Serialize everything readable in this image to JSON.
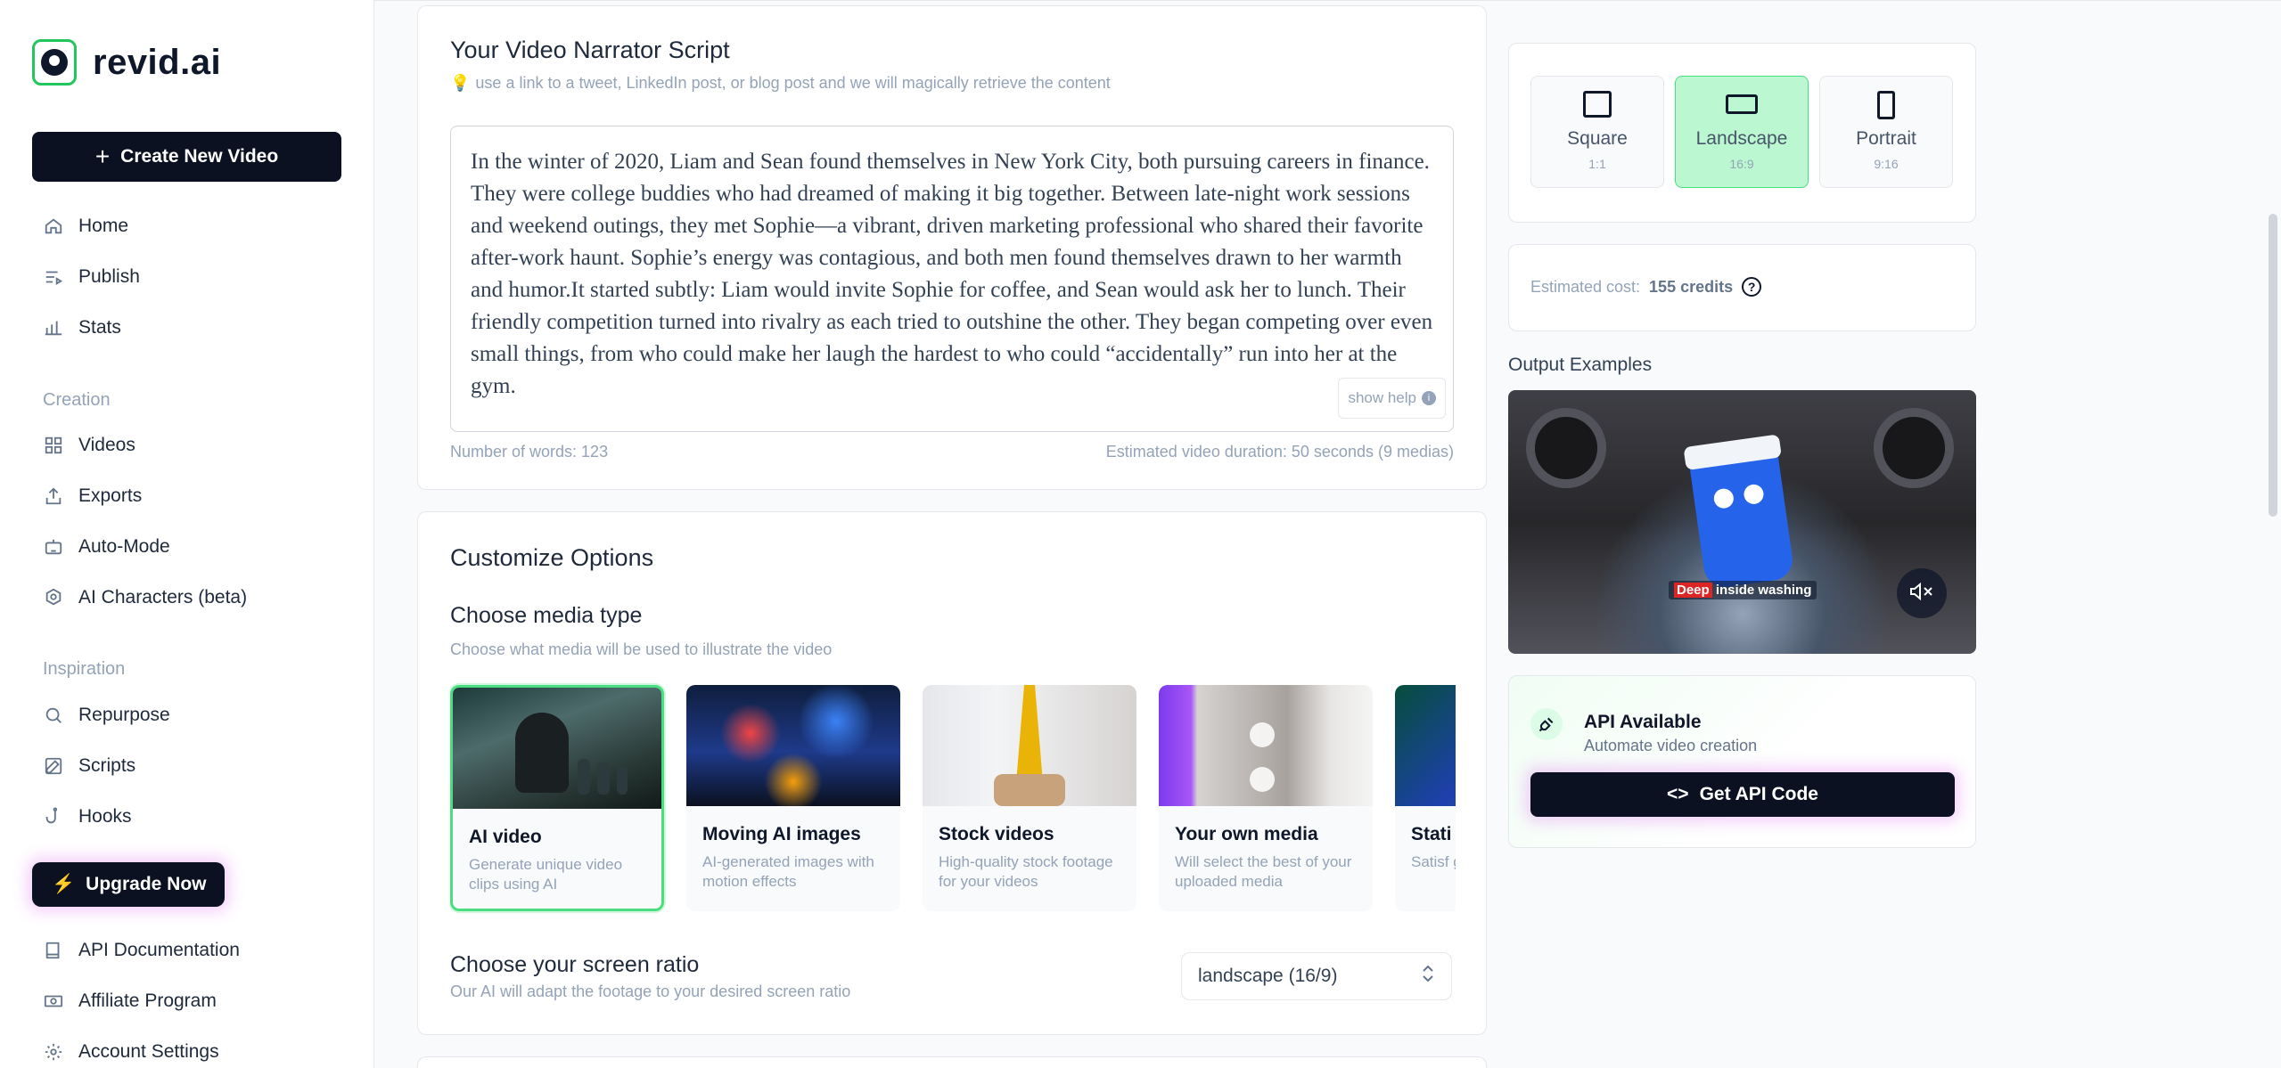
{
  "app": {
    "name": "revid.ai"
  },
  "sidebar": {
    "create_label": "Create New Video",
    "main_items": [
      {
        "label": "Home",
        "icon": "home-icon"
      },
      {
        "label": "Publish",
        "icon": "publish-icon"
      },
      {
        "label": "Stats",
        "icon": "stats-icon"
      }
    ],
    "creation_title": "Creation",
    "creation_items": [
      {
        "label": "Videos",
        "icon": "grid-icon"
      },
      {
        "label": "Exports",
        "icon": "export-icon"
      },
      {
        "label": "Auto-Mode",
        "icon": "robot-icon"
      },
      {
        "label": "AI Characters (beta)",
        "icon": "cog-icon"
      }
    ],
    "inspiration_title": "Inspiration",
    "inspiration_items": [
      {
        "label": "Repurpose",
        "icon": "search-icon"
      },
      {
        "label": "Scripts",
        "icon": "edit-icon"
      },
      {
        "label": "Hooks",
        "icon": "hook-icon"
      }
    ],
    "upgrade_label": "Upgrade Now",
    "bottom_items": [
      {
        "label": "API Documentation",
        "icon": "book-icon"
      },
      {
        "label": "Affiliate Program",
        "icon": "money-icon"
      },
      {
        "label": "Account Settings",
        "icon": "settings-icon"
      }
    ]
  },
  "script": {
    "title": "Your Video Narrator Script",
    "hint": "use a link to a tweet, LinkedIn post, or blog post and we will magically retrieve the content",
    "text": "In the winter of 2020, Liam and Sean found themselves in New York City, both pursuing careers in finance. They were college buddies who had dreamed of making it big together. Between late-night work sessions and weekend outings, they met Sophie—a vibrant, driven marketing professional who shared their favorite after-work haunt. Sophie’s energy was contagious, and both men found themselves drawn to her warmth and humor.It started subtly: Liam would invite Sophie for coffee, and Sean would ask her to lunch. Their friendly competition turned into rivalry as each tried to outshine the other. They began competing over even small things, from who could make her laugh the hardest to who could “accidentally” run into her at the gym.",
    "show_help": "show help",
    "word_count": "Number of words: 123",
    "duration": "Estimated video duration: 50 seconds (9 medias)"
  },
  "customize": {
    "title": "Customize Options",
    "media_title": "Choose media type",
    "media_sub": "Choose what media will be used to illustrate the video",
    "media_types": [
      {
        "title": "AI video",
        "desc": "Generate unique video clips using AI",
        "selected": true
      },
      {
        "title": "Moving AI images",
        "desc": "AI-generated images with motion effects",
        "selected": false
      },
      {
        "title": "Stock videos",
        "desc": "High-quality stock footage for your videos",
        "selected": false
      },
      {
        "title": "Your own media",
        "desc": "Will select the best of your uploaded media",
        "selected": false
      },
      {
        "title": "Stati",
        "desc": "Satisf grab a",
        "selected": false
      }
    ],
    "ratio_title": "Choose your screen ratio",
    "ratio_sub": "Our AI will adapt the footage to your desired screen ratio",
    "ratio_value": "landscape (16/9)"
  },
  "aspect": {
    "options": [
      {
        "name": "Square",
        "sub": "1:1",
        "active": false
      },
      {
        "name": "Landscape",
        "sub": "16:9",
        "active": true
      },
      {
        "name": "Portrait",
        "sub": "9:16",
        "active": false
      }
    ]
  },
  "cost": {
    "label": "Estimated cost:",
    "value": "155 credits"
  },
  "examples": {
    "label": "Output Examples",
    "caption_highlight": "Deep",
    "caption_rest": " inside washing"
  },
  "api": {
    "title": "API Available",
    "sub": "Automate video creation",
    "button": "Get API Code"
  },
  "colors": {
    "accent_green": "#4ade80",
    "dark": "#0b1120",
    "muted": "#94a3b8"
  }
}
